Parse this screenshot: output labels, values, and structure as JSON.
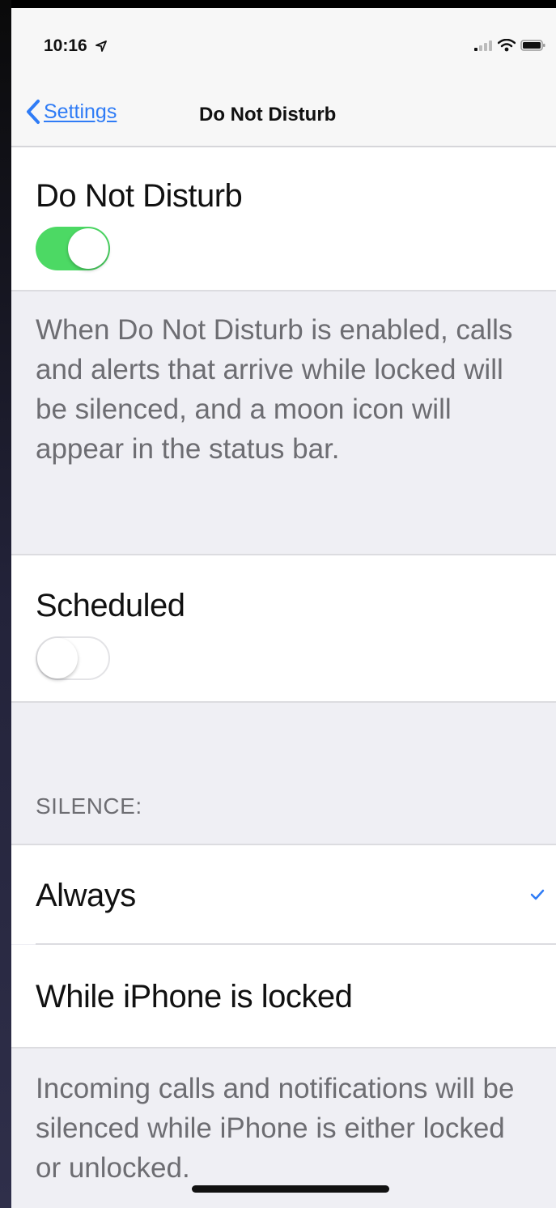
{
  "status_bar": {
    "time": "10:16",
    "icons": [
      "location-arrow-icon",
      "signal-icon",
      "wifi-icon",
      "battery-icon"
    ]
  },
  "nav": {
    "back_label": "Settings",
    "title": "Do Not Disturb",
    "accent": "#2f7cf6"
  },
  "dnd": {
    "label": "Do Not Disturb",
    "enabled": true,
    "description": "When Do Not Disturb is enabled, calls and alerts that arrive while locked will be silenced, and a moon icon will appear in the status bar."
  },
  "scheduled": {
    "label": "Scheduled",
    "enabled": false
  },
  "silence": {
    "header": "SILENCE:",
    "options": [
      {
        "label": "Always",
        "selected": true
      },
      {
        "label": "While iPhone is locked",
        "selected": false
      }
    ],
    "footer": "Incoming calls and notifications will be silenced while iPhone is either locked or unlocked."
  },
  "colors": {
    "toggle_on": "#4cd964",
    "background": "#efeff4"
  }
}
